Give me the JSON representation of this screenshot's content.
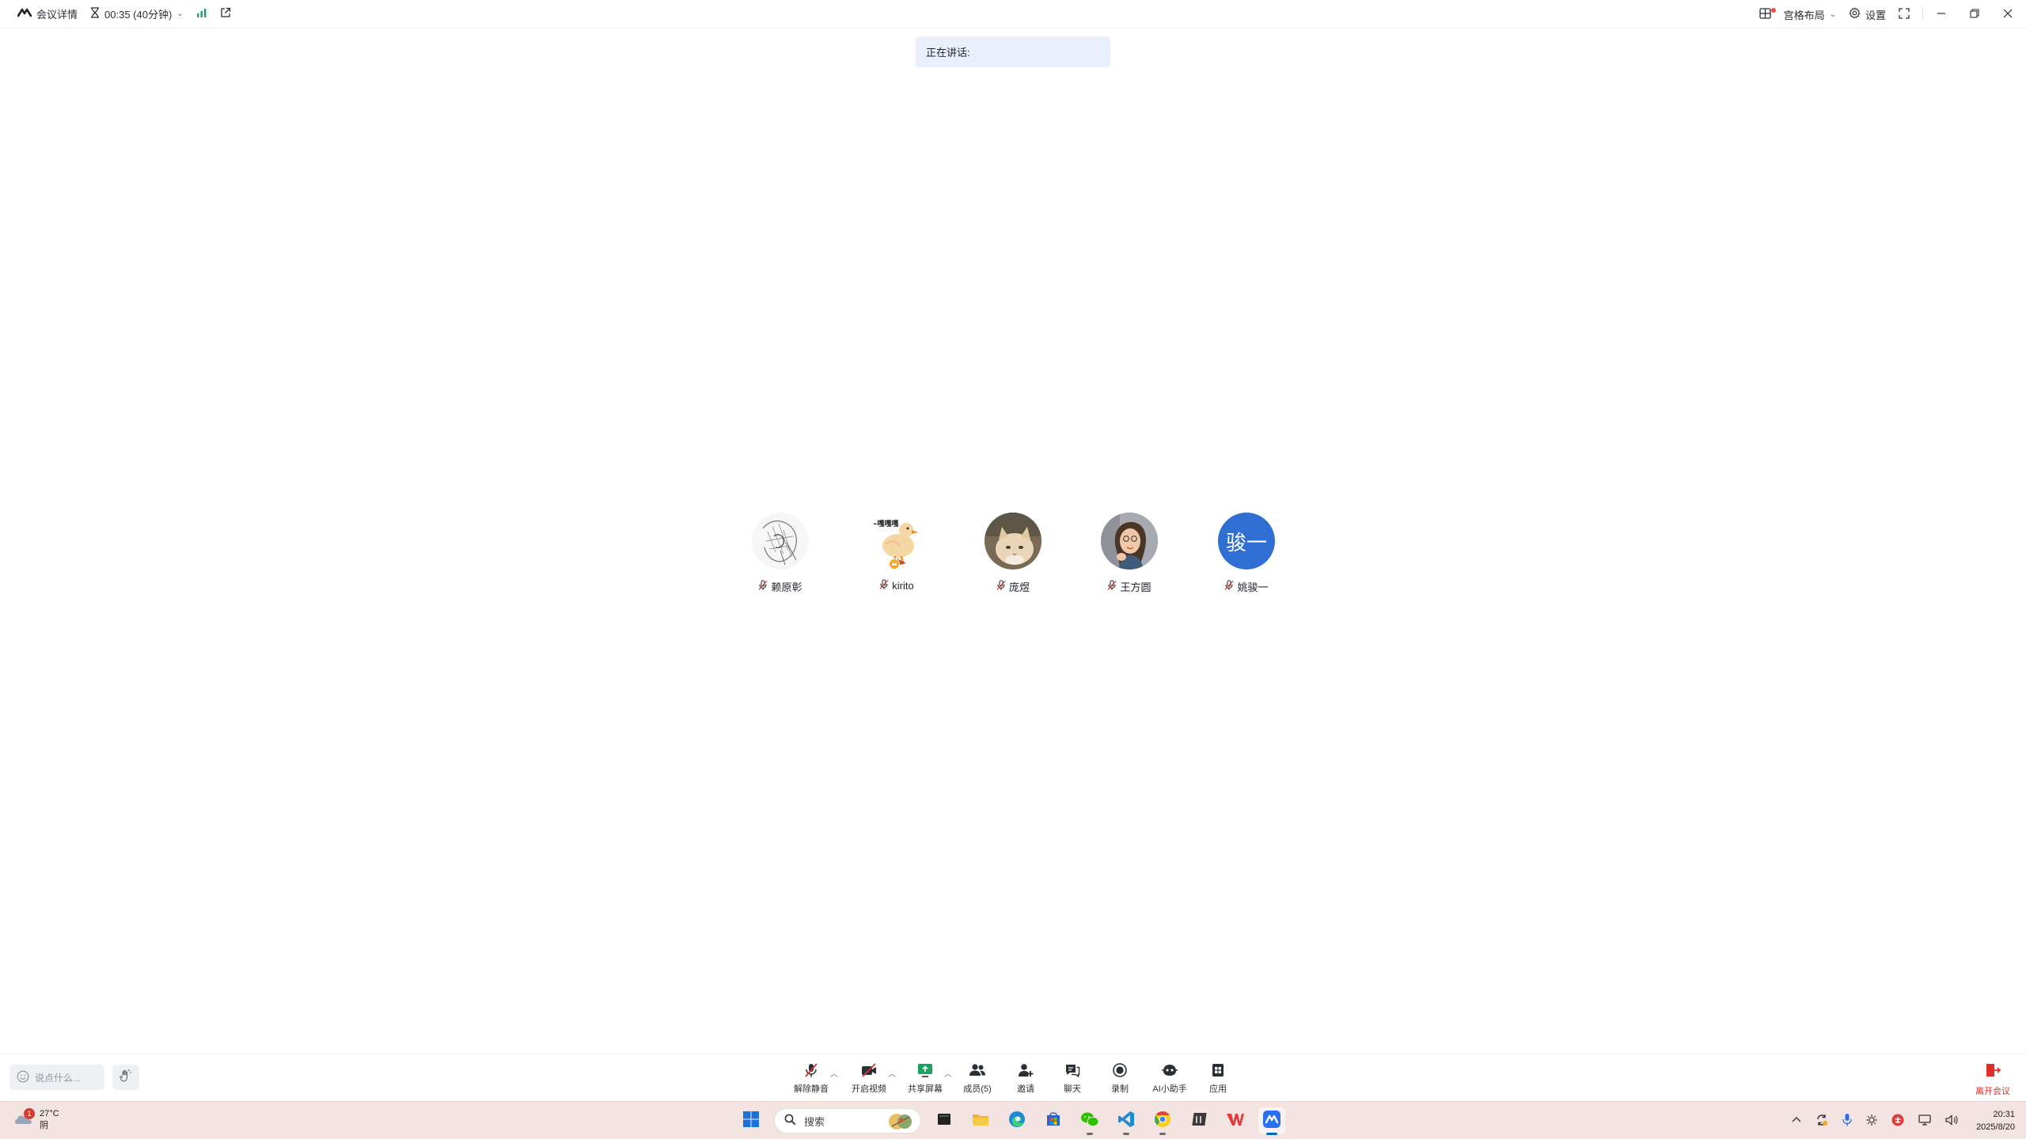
{
  "topbar": {
    "meeting_details_label": "会议详情",
    "timer_label": "00:35 (40分钟)",
    "layout_label": "宫格布局",
    "settings_label": "设置"
  },
  "speaking_banner": {
    "label": "正在讲话:"
  },
  "participants": [
    {
      "name": "赖原彰",
      "avatar_type": "sketch",
      "mic": "muted"
    },
    {
      "name": "kirito",
      "avatar_type": "duck",
      "mic": "muted",
      "host_badge": true
    },
    {
      "name": "庞煜",
      "avatar_type": "cat",
      "mic": "muted"
    },
    {
      "name": "王方圆",
      "avatar_type": "photo",
      "mic": "muted"
    },
    {
      "name": "姚骏一",
      "avatar_type": "initials",
      "avatar_text": "骏一",
      "avatar_color": "#2f6fd3",
      "mic": "muted"
    }
  ],
  "toolbar": {
    "chat_placeholder": "说点什么...",
    "unmute_label": "解除静音",
    "start_video_label": "开启视频",
    "share_screen_label": "共享屏幕",
    "members_label": "成员(5)",
    "invite_label": "邀请",
    "chat_label": "聊天",
    "record_label": "录制",
    "ai_assistant_label": "AI小助手",
    "apps_label": "应用",
    "leave_label": "离开会议"
  },
  "taskbar": {
    "weather_temp": "27°C",
    "weather_desc": "阴",
    "weather_badge": "1",
    "search_label": "搜索",
    "time": "20:31",
    "date": "2025/8/20",
    "pinned_apps": [
      "start-icon",
      "search-box",
      "desktop-icon",
      "file-explorer-icon",
      "edge-icon",
      "store-icon",
      "wechat-icon",
      "vscode-icon",
      "chrome-icon",
      "typora-icon",
      "wps-icon",
      "tencent-meeting-icon"
    ]
  },
  "colors": {
    "accent": "#1f6feb",
    "leave_red": "#e22e28",
    "banner_bg": "#eaf0fb",
    "taskbar_bg": "#f3e3e1"
  }
}
